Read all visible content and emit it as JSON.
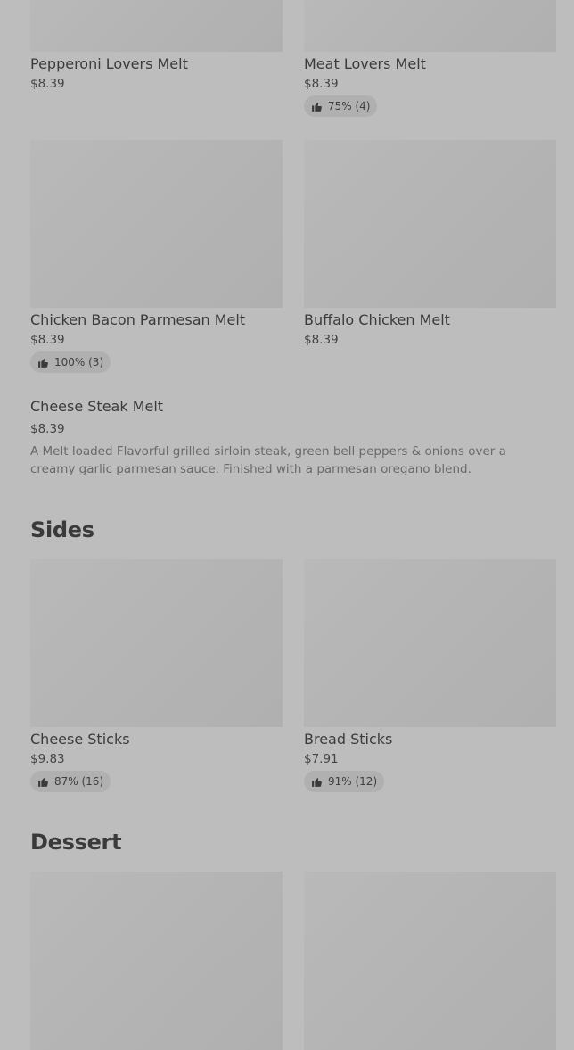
{
  "melts": {
    "items": [
      {
        "name": "Pepperoni Lovers Melt",
        "price": "$8.39",
        "rating": ""
      },
      {
        "name": "Meat Lovers Melt",
        "price": "$8.39",
        "rating": "75% (4)"
      },
      {
        "name": "Chicken Bacon Parmesan Melt",
        "price": "$8.39",
        "rating": "100% (3)"
      },
      {
        "name": "Buffalo Chicken Melt",
        "price": "$8.39",
        "rating": ""
      }
    ],
    "featured": {
      "name": "Cheese Steak Melt",
      "price": "$8.39",
      "description": "A Melt loaded Flavorful grilled sirloin steak, green bell peppers & onions over a creamy garlic parmesan sauce. Finished with a parmesan oregano blend."
    }
  },
  "sides": {
    "title": "Sides",
    "items": [
      {
        "name": "Cheese Sticks",
        "price": "$9.83",
        "rating": "87% (16)"
      },
      {
        "name": "Bread Sticks",
        "price": "$7.91",
        "rating": "91% (12)"
      }
    ]
  },
  "dessert": {
    "title": "Dessert"
  },
  "icons": {
    "rating": "thumbs-up-icon"
  }
}
